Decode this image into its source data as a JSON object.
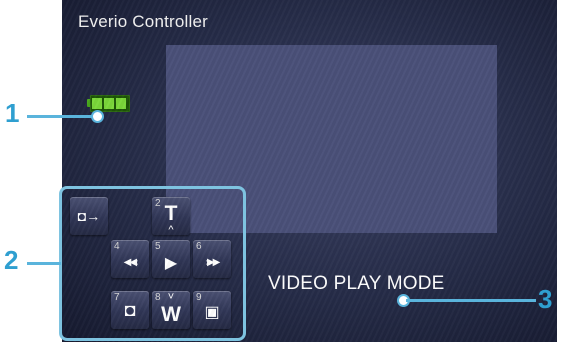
{
  "app": {
    "title": "Everio Controller"
  },
  "status": {
    "mode": "VIDEO PLAY MODE",
    "battery_cells": 3
  },
  "callouts": {
    "battery": "1",
    "controls": "2",
    "mode": "3"
  },
  "controls": {
    "mode_switch": {
      "label": "◘→",
      "icon": "camera-switch-icon"
    },
    "zoom_tele": {
      "number": "2",
      "label": "T",
      "chevron": "^"
    },
    "rewind": {
      "number": "4",
      "label": "◀◀‹"
    },
    "play": {
      "number": "5",
      "label": "▶"
    },
    "fast_forward": {
      "number": "6",
      "label": "›▶▶"
    },
    "snapshot": {
      "number": "7",
      "label": "◘",
      "icon": "camera-icon"
    },
    "zoom_wide": {
      "number": "8",
      "label": "W",
      "chevron": "˅"
    },
    "index": {
      "number": "9",
      "label": "▣",
      "icon": "index-grid-icon"
    }
  },
  "colors": {
    "callout": "#2f9fd0",
    "callout_line": "#5ab4dc",
    "battery": "#7bd83a",
    "preview": "#4a5079",
    "screen_background": "#252b47"
  }
}
